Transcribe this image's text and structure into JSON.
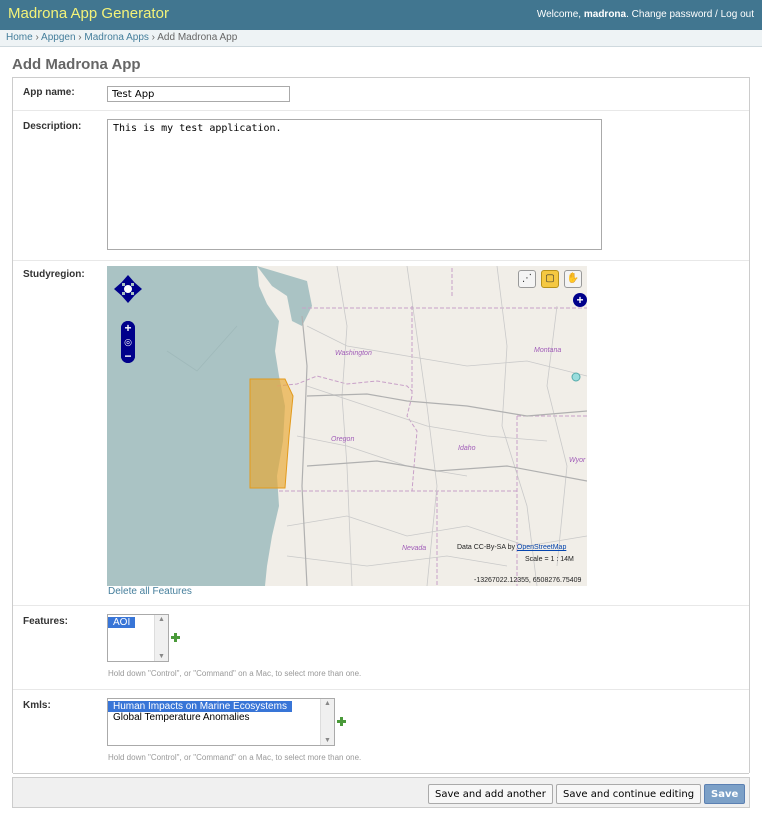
{
  "header": {
    "branding": "Madrona App Generator",
    "welcome": "Welcome, ",
    "username": "madrona",
    "period": ".",
    "change_password": "Change password",
    "separator": " / ",
    "logout": "Log out"
  },
  "breadcrumbs": {
    "home": "Home",
    "appgen": "Appgen",
    "apps": "Madrona Apps",
    "current": "Add Madrona App",
    "sep": " › "
  },
  "title": "Add Madrona App",
  "form": {
    "app_name_label": "App name:",
    "app_name_value": "Test App",
    "description_label": "Description:",
    "description_value": "This is my test application.",
    "studyregion_label": "Studyregion:",
    "delete_all_features": "Delete all Features",
    "features_label": "Features:",
    "features_options": [
      "AOI"
    ],
    "features_help": "Hold down \"Control\", or \"Command\" on a Mac, to select more than one.",
    "kmls_label": "Kmls:",
    "kmls_options": [
      "Human Impacts on Marine Ecosystems",
      "Global Temperature Anomalies"
    ],
    "kmls_help": "Hold down \"Control\", or \"Command\" on a Mac, to select more than one."
  },
  "map": {
    "labels": {
      "washington": "Washington",
      "montana": "Montana",
      "oregon": "Oregon",
      "idaho": "Idaho",
      "wyoming": "Wyor",
      "nevada": "Nevada"
    },
    "attribution_prefix": "Data CC-By-SA by ",
    "attribution_link": "OpenStreetMap",
    "scale": "Scale = 1 : 14M",
    "coords": "-13267022.12355, 6508276.75409",
    "colors": {
      "ocean": "#aac3c4",
      "land": "#f1eee8",
      "polygon_fill": "#e9a830",
      "polygon_stroke": "#e39a1c"
    },
    "icons": [
      "pan-arrows-icon",
      "zoom-in-icon",
      "world-icon",
      "zoom-out-icon",
      "draw-point-icon",
      "draw-polygon-icon",
      "pan-hand-icon",
      "layer-switcher-icon"
    ]
  },
  "buttons": {
    "save_add_another": "Save and add another",
    "save_continue": "Save and continue editing",
    "save": "Save"
  }
}
